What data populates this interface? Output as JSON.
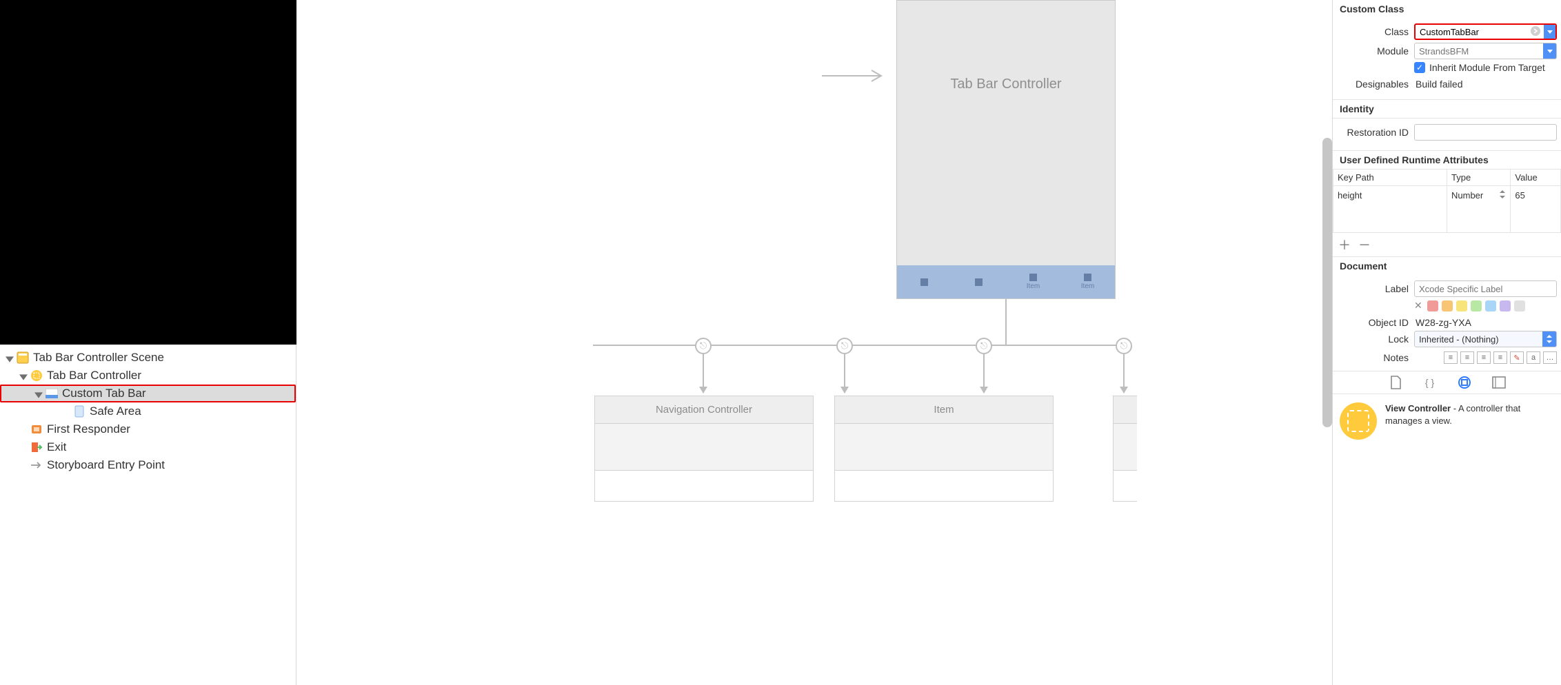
{
  "outline": {
    "scene": "Tab Bar Controller Scene",
    "items": [
      {
        "label": "Tab Bar Controller",
        "icon": "vc-icon"
      },
      {
        "label": "Custom Tab Bar",
        "icon": "tabbar-icon",
        "selected": true
      },
      {
        "label": "Safe Area",
        "icon": "safearea-icon"
      },
      {
        "label": "First Responder",
        "icon": "firstresponder-icon"
      },
      {
        "label": "Exit",
        "icon": "exit-icon"
      },
      {
        "label": "Storyboard Entry Point",
        "icon": "entry-icon"
      }
    ]
  },
  "canvas": {
    "main_title": "Tab Bar Controller",
    "tabbar_items": [
      "",
      "",
      "Item",
      "Item"
    ],
    "dest_left": "Navigation Controller",
    "dest_mid": "Item"
  },
  "inspector": {
    "custom_class_header": "Custom Class",
    "class_label": "Class",
    "class_value": "CustomTabBar",
    "module_label": "Module",
    "module_placeholder": "StrandsBFM",
    "inherit_label": "Inherit Module From Target",
    "designables_label": "Designables",
    "designables_value": "Build failed",
    "identity_header": "Identity",
    "restoration_label": "Restoration ID",
    "udra_header": "User Defined Runtime Attributes",
    "udra_cols": {
      "keypath": "Key Path",
      "type": "Type",
      "value": "Value"
    },
    "udra_row": {
      "keypath": "height",
      "type": "Number",
      "value": "65"
    },
    "document_header": "Document",
    "label_label": "Label",
    "label_placeholder": "Xcode Specific Label",
    "swatch_colors": [
      "#f09b97",
      "#f7c573",
      "#f7e47a",
      "#b8e8a3",
      "#a9d6f7",
      "#c7b8f0",
      "#e0e0e0"
    ],
    "objectid_label": "Object ID",
    "objectid_value": "W28-zg-YXA",
    "lock_label": "Lock",
    "lock_value": "Inherited - (Nothing)",
    "notes_label": "Notes",
    "library_item_title": "View Controller",
    "library_item_desc": " - A controller that manages a view."
  }
}
